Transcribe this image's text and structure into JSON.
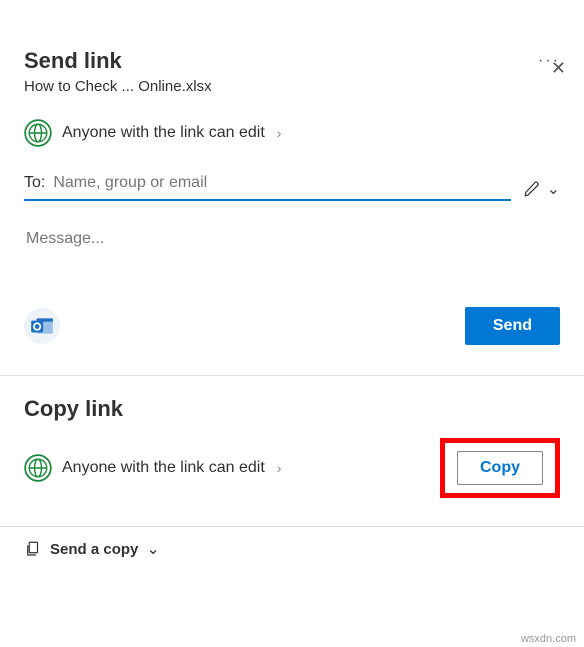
{
  "close": {
    "symbol": "✕"
  },
  "header": {
    "title": "Send link",
    "more": "···"
  },
  "file": {
    "name": "How to Check ... Online.xlsx"
  },
  "permission": {
    "label": "Anyone with the link can edit",
    "chevron": "›"
  },
  "recipients": {
    "prefix": "To:",
    "placeholder": "Name, group or email"
  },
  "edit": {
    "chevron": "⌄"
  },
  "message": {
    "placeholder": "Message..."
  },
  "send": {
    "label": "Send"
  },
  "copylink": {
    "title": "Copy link",
    "permission": "Anyone with the link can edit",
    "chevron": "›",
    "copy_label": "Copy"
  },
  "sendcopy": {
    "label": "Send a copy",
    "chevron": "⌄"
  },
  "footer": {
    "text": "wsxdn.com"
  }
}
